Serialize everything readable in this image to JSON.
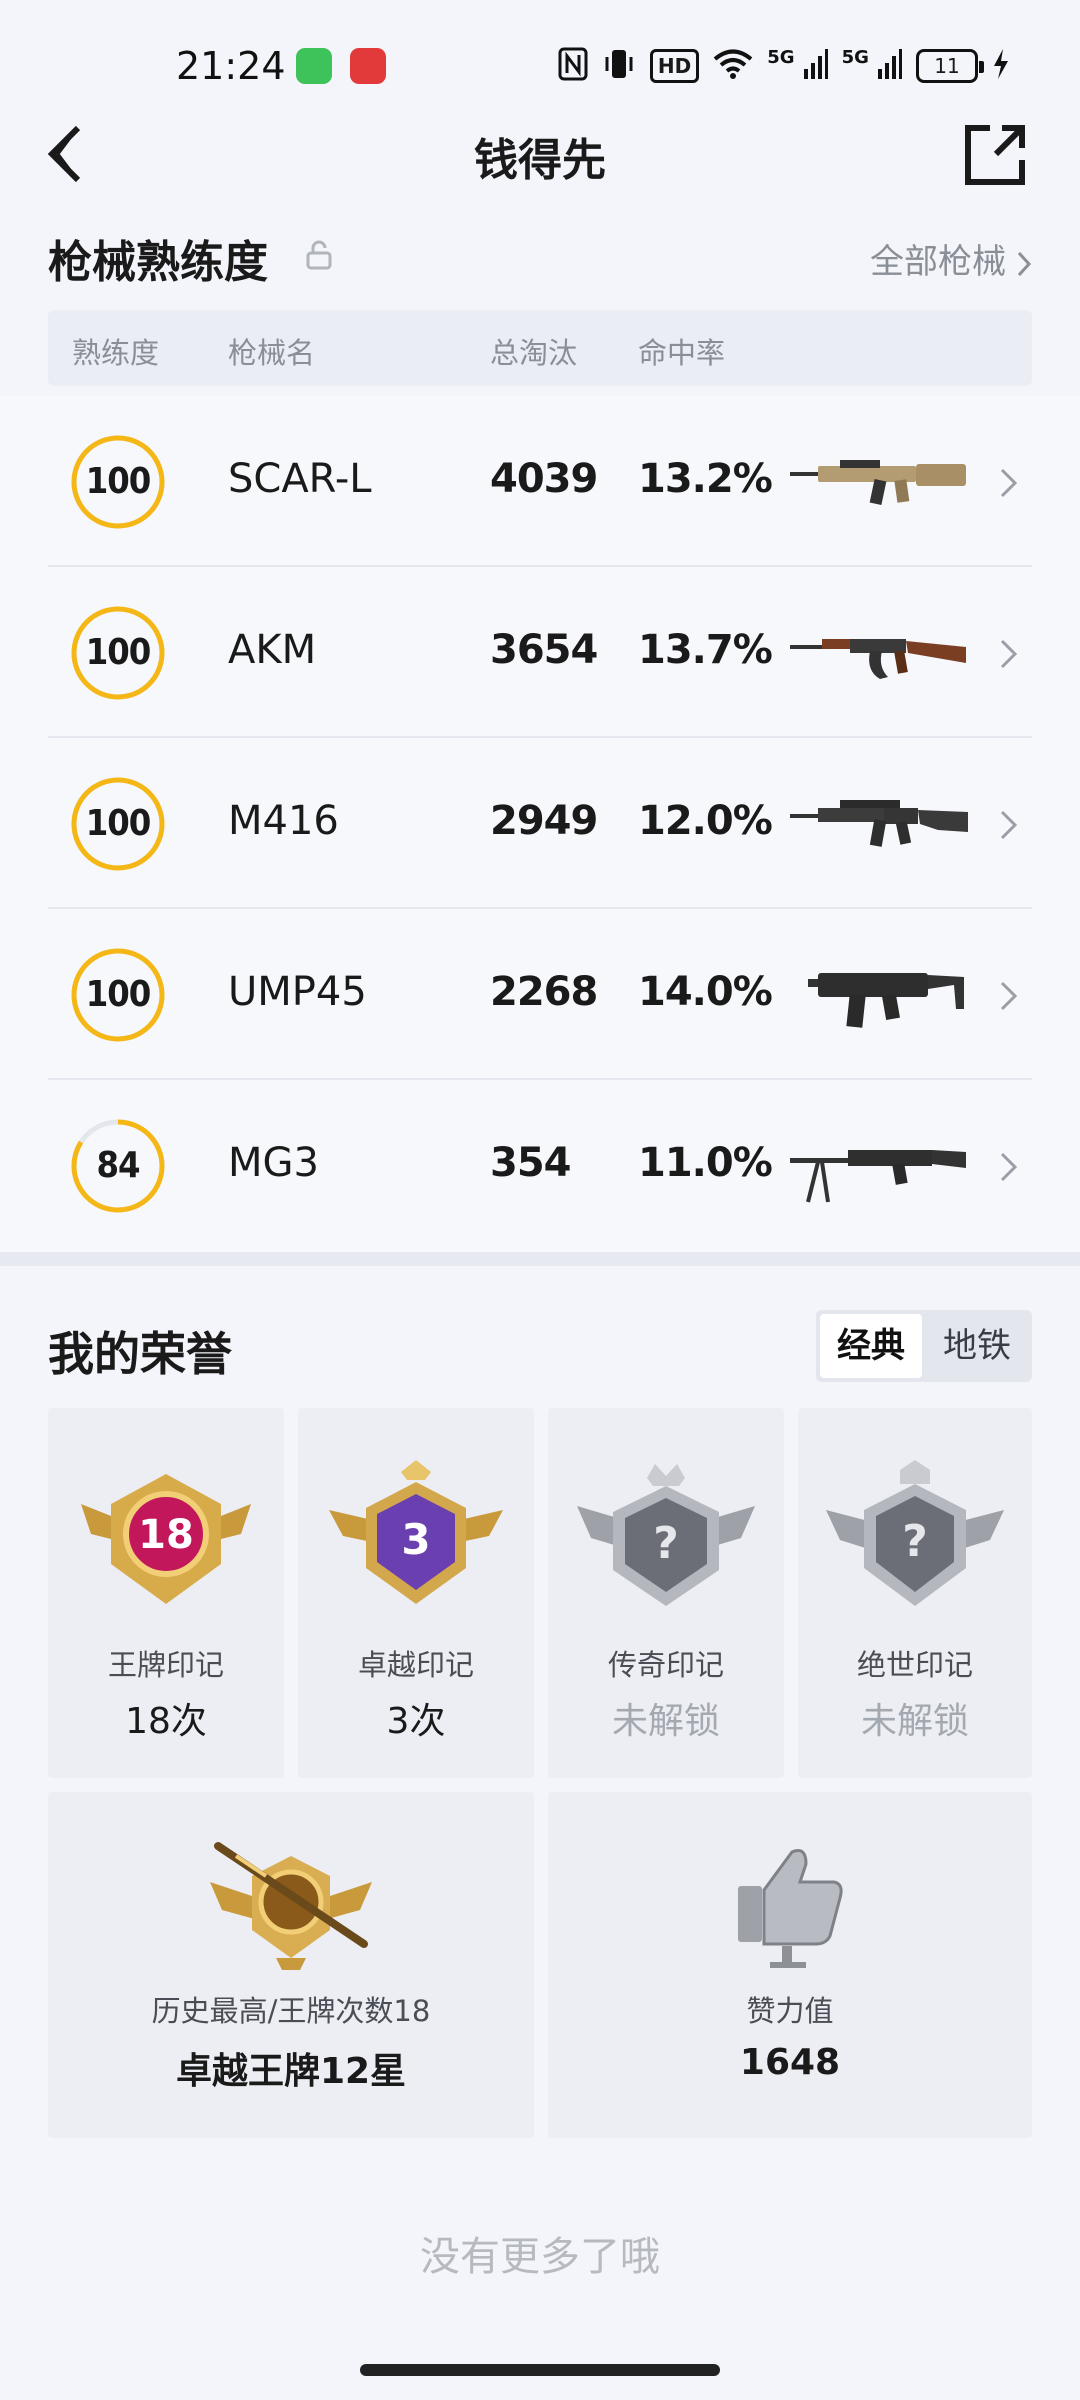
{
  "status_bar": {
    "time": "21:24",
    "hd_label": "HD",
    "signal1_label": "5G",
    "signal2_label": "5G",
    "battery_level": "11"
  },
  "header": {
    "title": "钱得先"
  },
  "weapon_section": {
    "title": "枪械熟练度",
    "all_link": "全部枪械",
    "columns": [
      "熟练度",
      "枪械名",
      "总淘汰",
      "命中率"
    ],
    "weapons": [
      {
        "proficiency": "100",
        "proficiency_fraction": 1.0,
        "name": "SCAR-L",
        "kills": "4039",
        "hit_rate": "13.2%",
        "icon": "scar-l-rifle-icon"
      },
      {
        "proficiency": "100",
        "proficiency_fraction": 1.0,
        "name": "AKM",
        "kills": "3654",
        "hit_rate": "13.7%",
        "icon": "akm-rifle-icon"
      },
      {
        "proficiency": "100",
        "proficiency_fraction": 1.0,
        "name": "M416",
        "kills": "2949",
        "hit_rate": "12.0%",
        "icon": "m416-rifle-icon"
      },
      {
        "proficiency": "100",
        "proficiency_fraction": 1.0,
        "name": "UMP45",
        "kills": "2268",
        "hit_rate": "14.0%",
        "icon": "ump45-smg-icon"
      },
      {
        "proficiency": "84",
        "proficiency_fraction": 0.84,
        "name": "MG3",
        "kills": "354",
        "hit_rate": "11.0%",
        "icon": "mg3-machine-gun-icon"
      }
    ]
  },
  "honor_section": {
    "title": "我的荣誉",
    "modes": [
      "经典",
      "地铁"
    ],
    "badges": [
      {
        "label": "王牌印记",
        "value": "18次",
        "emblem_number": "18",
        "locked": false,
        "icon": "ace-emblem-icon"
      },
      {
        "label": "卓越印记",
        "value": "3次",
        "emblem_number": "3",
        "locked": false,
        "icon": "conqueror-emblem-icon"
      },
      {
        "label": "传奇印记",
        "value": "未解锁",
        "emblem_number": "?",
        "locked": true,
        "icon": "legend-emblem-locked-icon"
      },
      {
        "label": "绝世印记",
        "value": "未解锁",
        "emblem_number": "?",
        "locked": true,
        "icon": "peerless-emblem-locked-icon"
      }
    ],
    "history": {
      "label": "历史最高/王牌次数18",
      "value": "卓越王牌12星",
      "icon": "rank-sniper-badge-icon"
    },
    "likes": {
      "label": "赞力值",
      "value": "1648",
      "icon": "thumbs-up-icon"
    }
  },
  "footer": {
    "no_more_text": "没有更多了哦"
  },
  "colors": {
    "background": "#f3f5fa",
    "ring_gold": "#f5b716",
    "ring_track": "#e3e6ec",
    "muted_text": "#8a8e96"
  }
}
